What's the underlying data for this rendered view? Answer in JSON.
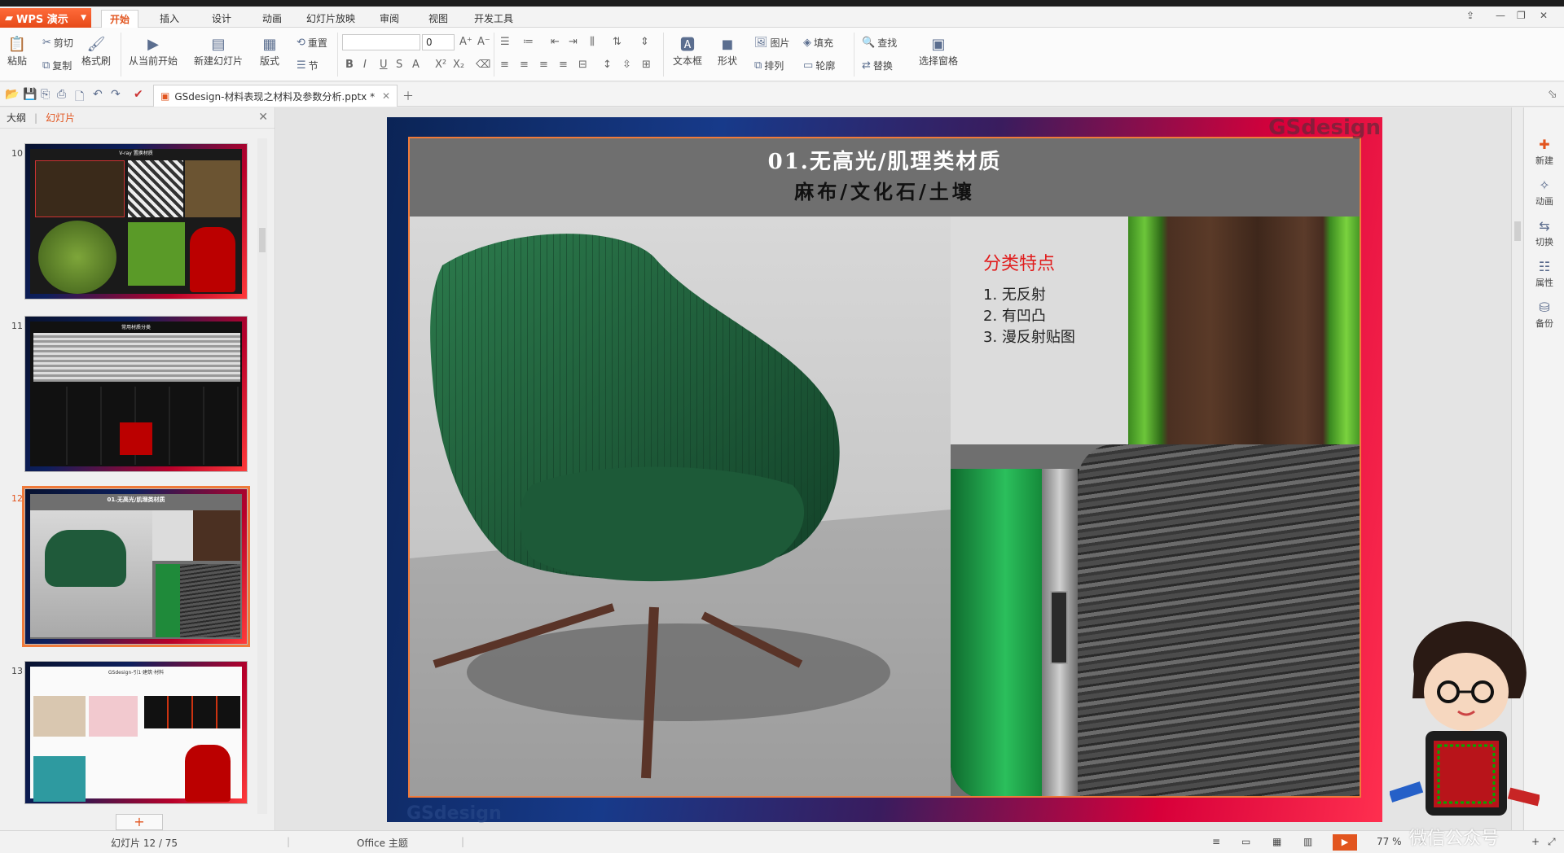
{
  "app": {
    "brand": "WPS 演示",
    "accent_color": "#e2551f",
    "tabs": [
      "开始",
      "插入",
      "设计",
      "动画",
      "幻灯片放映",
      "审阅",
      "视图",
      "开发工具"
    ],
    "active_tab": "开始"
  },
  "ribbon": {
    "paste": "粘贴",
    "cut": "剪切",
    "copy": "复制",
    "format_painter": "格式刷",
    "from_current": "从当前开始",
    "new_slide": "新建幻灯片",
    "layout": "版式",
    "reset": "重置",
    "section": "节",
    "font_name": "",
    "font_size": "0",
    "text_box": "文本框",
    "shape": "形状",
    "picture": "图片",
    "fill": "填充",
    "arrange": "排列",
    "outline": "轮廓",
    "find": "查找",
    "replace": "替换",
    "selection_pane": "选择窗格"
  },
  "document": {
    "tab_title": "GSdesign-材料表现之材料及参数分析.pptx *"
  },
  "left_panel": {
    "tab_outline": "大纲",
    "tab_slides": "幻灯片",
    "slides": [
      {
        "number": "10",
        "title": "V-ray 置换材质"
      },
      {
        "number": "11",
        "title": "常用材质分类"
      },
      {
        "number": "12",
        "title": "01.无高光/肌理类材质"
      },
      {
        "number": "13",
        "title": "GSdesign-引1·建筑·材料"
      }
    ],
    "selected_slide": "12"
  },
  "slide": {
    "title": "01.无高光/肌理类材质",
    "subtitle": "麻布/文化石/土壤",
    "feature_heading": "分类特点",
    "features": [
      "1. 无反射",
      "2. 有凹凸",
      "3. 漫反射贴图"
    ],
    "watermark": "GSdesign",
    "watermark_bottom": "GSdesign"
  },
  "task_pane": {
    "items": [
      "新建",
      "动画",
      "切换",
      "属性",
      "备份"
    ]
  },
  "status": {
    "slide_counter": "幻灯片 12 / 75",
    "theme": "Office 主题",
    "zoom": "77 %"
  },
  "overlay": {
    "watermark_text": "微信公众号"
  },
  "colors": {
    "chair_green": "#1f5a3a",
    "feature_heading_red": "#e11d1d",
    "slide_border": "#f07a3a"
  }
}
